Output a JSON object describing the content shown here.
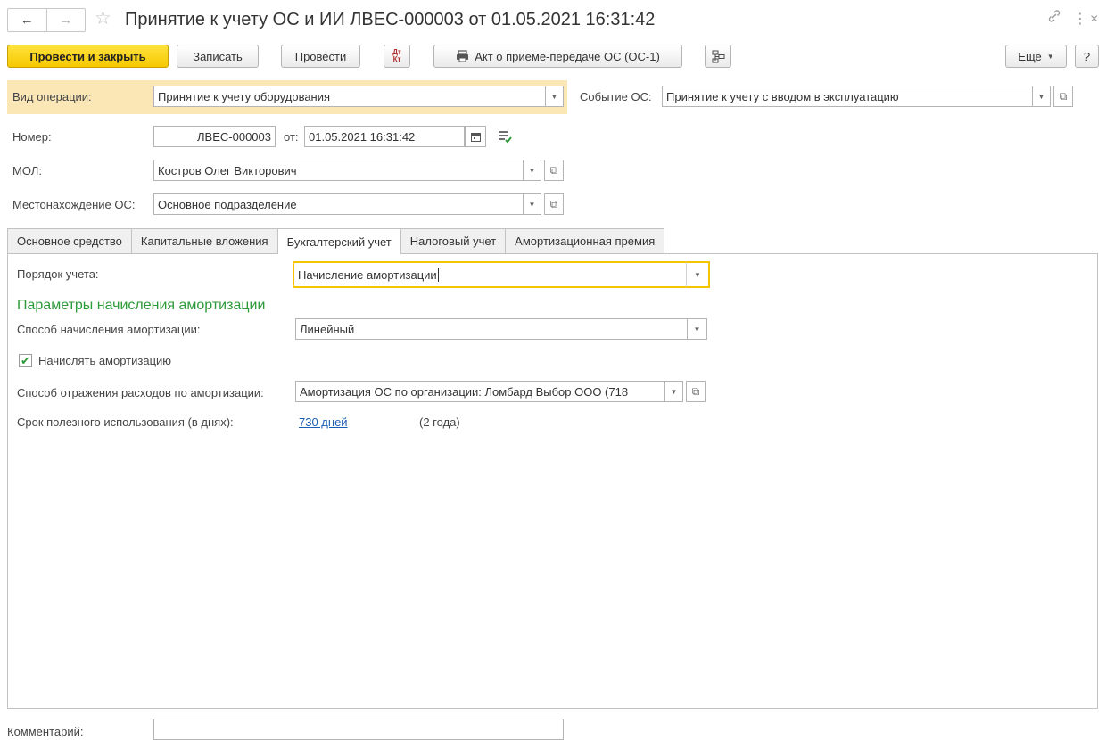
{
  "window": {
    "title": "Принятие к учету ОС и ИИ ЛВЕС-000003 от 01.05.2021 16:31:42",
    "back_icon": "←",
    "forward_icon": "→",
    "star_icon": "☆",
    "link_icon": "🔗",
    "menu_icon": "⋮",
    "close_icon": "×"
  },
  "toolbar": {
    "post_close": "Провести и закрыть",
    "save": "Записать",
    "post": "Провести",
    "dtkt_top": "Дт",
    "dtkt_bottom": "Кт",
    "act": "Акт о приеме-передаче ОС (ОС-1)",
    "more": "Еще",
    "help": "?"
  },
  "header": {
    "operation_label": "Вид операции:",
    "operation_value": "Принятие к учету оборудования",
    "event_label": "Событие ОС:",
    "event_value": "Принятие к учету с вводом в эксплуатацию",
    "number_label": "Номер:",
    "number_value": "ЛВЕС-000003",
    "date_label": "от:",
    "date_value": "01.05.2021 16:31:42",
    "mol_label": "МОЛ:",
    "mol_value": "Костров Олег Викторович",
    "location_label": "Местонахождение ОС:",
    "location_value": "Основное подразделение"
  },
  "tabs": [
    {
      "label": "Основное средство",
      "active": false
    },
    {
      "label": "Капитальные вложения",
      "active": false
    },
    {
      "label": "Бухгалтерский учет",
      "active": true
    },
    {
      "label": "Налоговый учет",
      "active": false
    },
    {
      "label": "Амортизационная премия",
      "active": false
    }
  ],
  "accounting": {
    "order_label": "Порядок учета:",
    "order_value": "Начисление амортизации",
    "section_title": "Параметры начисления амортизации",
    "method_label": "Способ начисления амортизации:",
    "method_value": "Линейный",
    "charge_label": "Начислять амортизацию",
    "charge_checked": true,
    "expense_label": "Способ отражения расходов по амортизации:",
    "expense_value": "Амортизация ОС по организации: Ломбард Выбор ООО (718",
    "life_label": "Срок полезного использования (в днях):",
    "life_value": "730 дней",
    "life_note": "(2 года)"
  },
  "footer": {
    "comment_label": "Комментарий:",
    "comment_value": ""
  },
  "colors": {
    "primary_button": "#f6c800",
    "highlight_band": "#fbe6b6",
    "section_title": "#2d9a3a",
    "link": "#1a5fb4",
    "focus": "#f5c400"
  }
}
